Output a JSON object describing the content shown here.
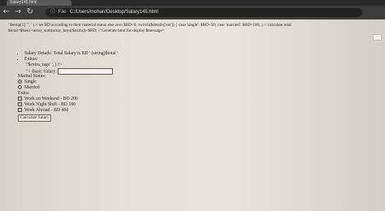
{
  "browser": {
    "tab_title": "Salary145.html",
    "back_icon": "arrow-left",
    "forward_icon": "arrow-right",
    "reload_icon": "reload",
    "address_scheme": "File",
    "address_path": "C:/Users/mohan/Desktop/Salary145.html"
  },
  "code_lines": [
    "' $temp[1] \"', ' ) // set BD according to their material status else zero $BD=0; switch($details['ms']) { case 'single': $BD=50; case 'married': $BD=100; } // calculate total",
    "$total=$basic+array_sum(array_keys($extra))+$BD; // Generate html for display $message="
  ],
  "summary": {
    "salary_details": "Salary Details: Total Salary is BD ' (string)$total '",
    "extras_label": "Extras:",
    "extras_value": "\"$extra_tags' ', ) ?>",
    "basic_salary_label": "\"> Basic Salary:",
    "marital_status_label": "Marital Status:",
    "single_label": "Single",
    "married_label": "Married",
    "extra_label": "Extra:",
    "extra_options": [
      "Work on Weekend - BD 200",
      "Work Night Shift - BD 100",
      "Work Abroad - BD 400"
    ],
    "calculate_button": "Calculate Salary"
  }
}
